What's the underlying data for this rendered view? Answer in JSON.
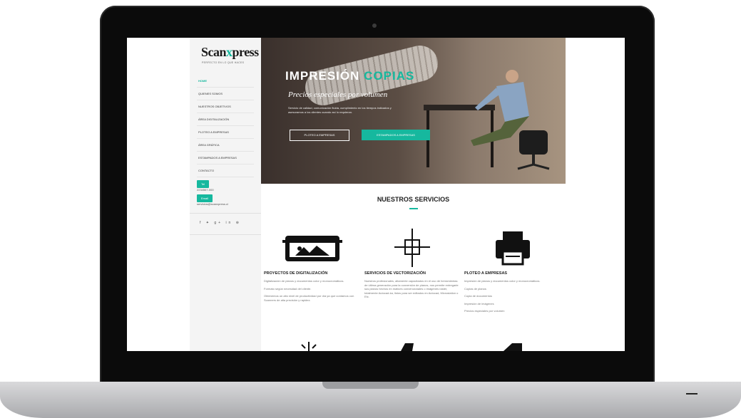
{
  "site": {
    "logo_main": "Scan",
    "logo_x": "x",
    "logo_end": "press",
    "logo_sub": "PERFECTO EN LO QUE HACES"
  },
  "nav": {
    "items": [
      {
        "label": "HOME",
        "active": true
      },
      {
        "label": "QUIENES SOMOS"
      },
      {
        "label": "NUESTROS OBJETIVOS"
      },
      {
        "label": "ÁREA DIGITALIZACIÓN"
      },
      {
        "label": "PLOTEO A EMPRESAS"
      },
      {
        "label": "ÁREA GRÁFICA"
      },
      {
        "label": "ESTAMPADOS A EMPRESAS"
      },
      {
        "label": "CONTACTO"
      }
    ]
  },
  "contact": {
    "phone_label": "Tel",
    "phone": "2234567-000",
    "email_label": "Email",
    "email": "servicios@scanxpress.cl"
  },
  "social": {
    "icons": [
      "facebook-icon",
      "twitter-icon",
      "google-plus-icon",
      "linkedin-icon",
      "pinterest-icon"
    ],
    "glyphs": "f ✦ g+ in ⊛"
  },
  "hero": {
    "title_main": "IMPRESIÓN",
    "title_accent": "COPIAS",
    "subtitle": "Precios especiales por volumen",
    "description": "Servicio de calidad, comunicación fluida, cumplimiento en los tiempos indicados y asesoramos a los clientes cuando así lo requieran.",
    "button_outline": "PLOTEO A EMPRESAS",
    "button_primary": "ESTAMPADOS A EMPRESAS"
  },
  "services": {
    "title": "NUESTROS SERVICIOS",
    "items": [
      {
        "icon": "scanner-icon",
        "title": "PROYECTOS DE DIGITALIZACIÓN",
        "lines": [
          "Digitalización de planos y documentos color y monocromáticos.",
          "Formato según necesidad del cliente.",
          "Obtenemos un alto nivel de productividad por día ya que contamos con Scanners de alta precisión y rapidez."
        ]
      },
      {
        "icon": "crosshair-icon",
        "title": "SERVICIOS DE VECTORIZACIÓN",
        "lines": [
          "Nuestros profesionales, altamente capacitados en el uso de herramientas de última generación para la conversión de planos, nos permite entregarle sus planos hechos en matices convencionales o imágenes raster, totalmente Autocad-ka, listos para ser editados en Autocad, Microstation o Etc."
        ]
      },
      {
        "icon": "printer-icon",
        "title": "PLOTEO A EMPRESAS",
        "lines": [
          "Impresión de planos y documentos color y monocromáticos.",
          "Copias de planos",
          "Copia de documentos",
          "Impresión de imágenes",
          "Precios especiales por volumen"
        ]
      }
    ]
  }
}
